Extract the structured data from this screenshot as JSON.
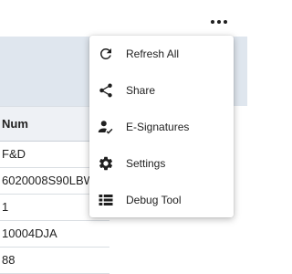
{
  "table": {
    "header": "Num",
    "rows": [
      "F&D",
      "6020008S90LBW",
      "1",
      "10004DJA",
      "88"
    ]
  },
  "menu": {
    "items": [
      {
        "label": "Refresh All",
        "icon": "refresh-icon"
      },
      {
        "label": "Share",
        "icon": "share-icon"
      },
      {
        "label": "E-Signatures",
        "icon": "e-signature-icon"
      },
      {
        "label": "Settings",
        "icon": "gear-icon"
      },
      {
        "label": "Debug Tool",
        "icon": "list-icon"
      }
    ]
  },
  "colors": {
    "highlight": "#fff200",
    "band": "#dfe6ee",
    "menu_bg": "#ffffff"
  }
}
